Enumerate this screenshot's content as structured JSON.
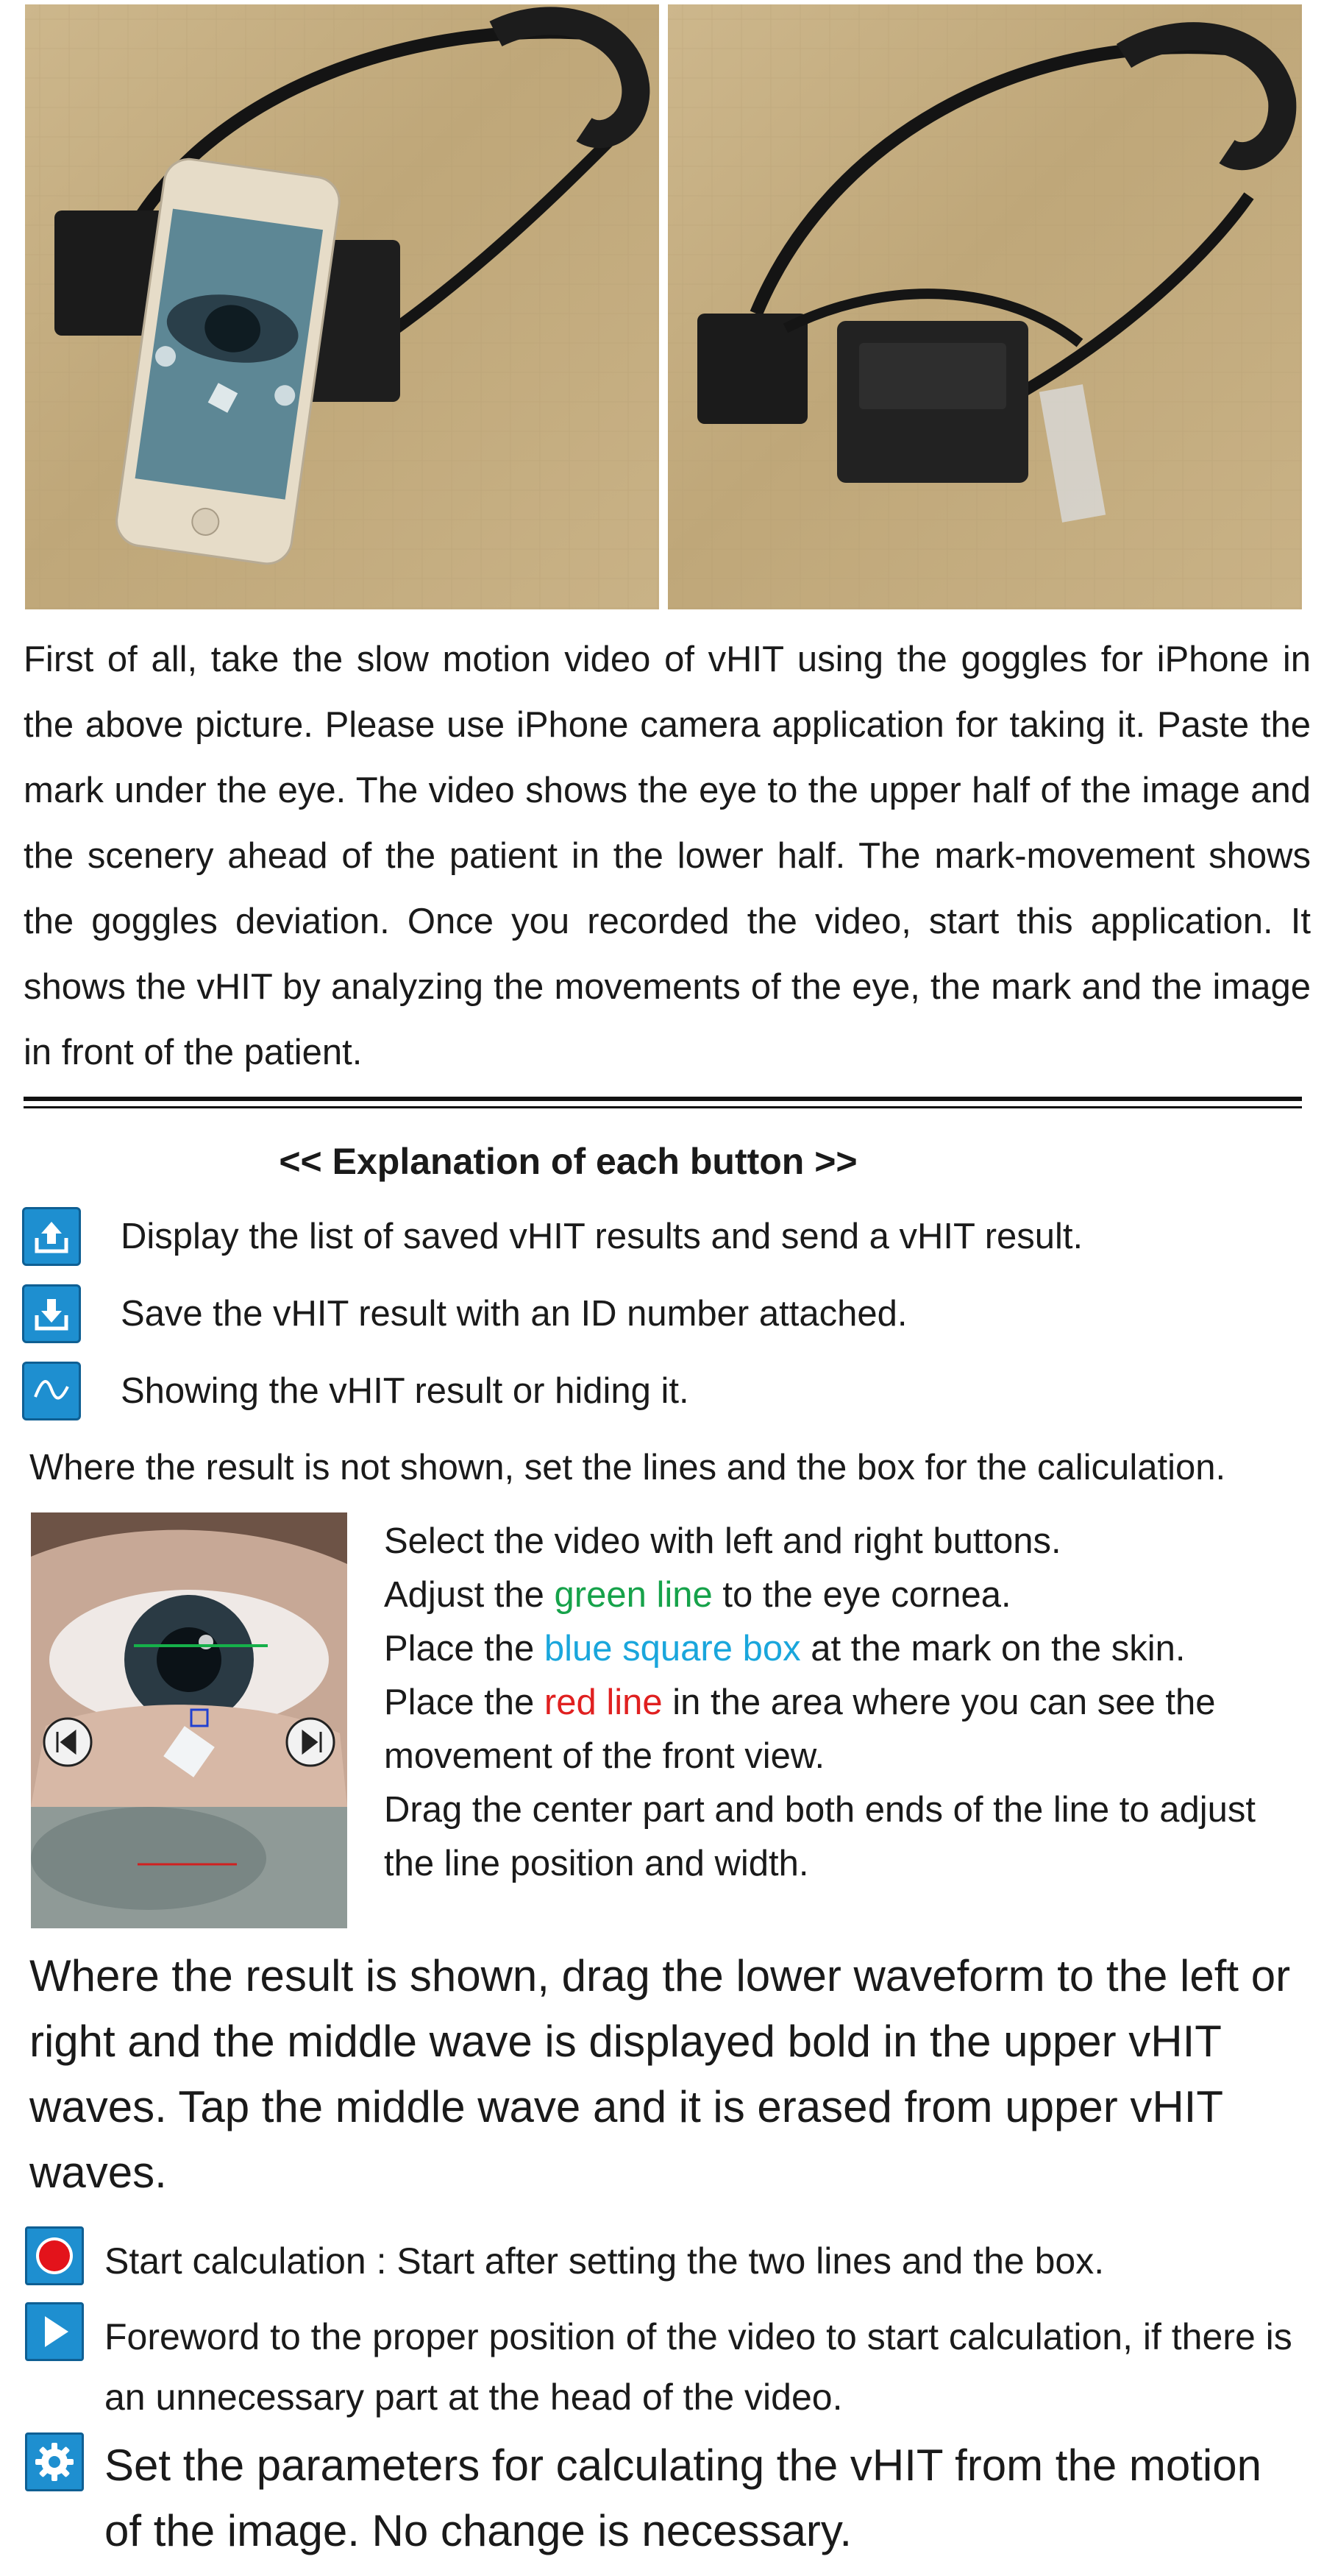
{
  "photos": {
    "left_alt": "Goggles with iPhone attached",
    "right_alt": "Goggles without iPhone"
  },
  "intro": {
    "text": "First of all, take the slow motion video of vHIT using the goggles for iPhone in the above picture. Please use iPhone camera application for taking it. Paste the mark under the eye. The video shows the eye to the upper half of the image and the scenery ahead of the patient in the lower half. The mark-movement shows the goggles deviation. Once you recorded the video, start this application. It shows the vHIT by analyzing the movements of the eye, the mark and the image in front of the patient."
  },
  "section": {
    "title": "<< Explanation of each button >>"
  },
  "buttons": [
    {
      "icon": "upload-icon",
      "text": "Display the list of saved vHIT results and send a vHIT result."
    },
    {
      "icon": "download-icon",
      "text": "Save the vHIT result with an ID number attached."
    },
    {
      "icon": "wave-icon",
      "text": "Showing the vHIT result or hiding it."
    }
  ],
  "where_not_shown": "Where the result is not shown, set the lines and the box for the caliculation.",
  "steps": {
    "s1": "Select the video with left and right buttons.",
    "s2_pre": "Adjust the ",
    "s2_color": "green line",
    "s2_post": " to the eye cornea.",
    "s3_pre": "Place the ",
    "s3_color": "blue square box",
    "s3_post": " at the mark on the skin.",
    "s4_pre": "Place the ",
    "s4_color": "red line",
    "s4_post": " in the area where you can see the movement of the front view.",
    "s5": "Drag the center part and both ends of the line to adjust the line position and width."
  },
  "where_shown": "Where the result is shown, drag the lower waveform to the left or right and the middle wave is displayed bold in the upper vHIT waves. Tap the middle wave and it is erased from upper vHIT waves.",
  "controls": [
    {
      "icon": "record-icon",
      "text": "Start calculation : Start after setting the two lines and the box."
    },
    {
      "icon": "play-icon",
      "text": "Foreword to the proper position of the video to start calculation, if there is an unnecessary part at the head of the video."
    },
    {
      "icon": "gear-icon",
      "text": "Set the parameters for calculating the vHIT from the motion of the image. No change is necessary."
    }
  ],
  "colors": {
    "accent_blue": "#1e8fd0",
    "green_line": "#16a24a",
    "blue_box": "#1aa6dc",
    "red_line": "#e02020"
  }
}
